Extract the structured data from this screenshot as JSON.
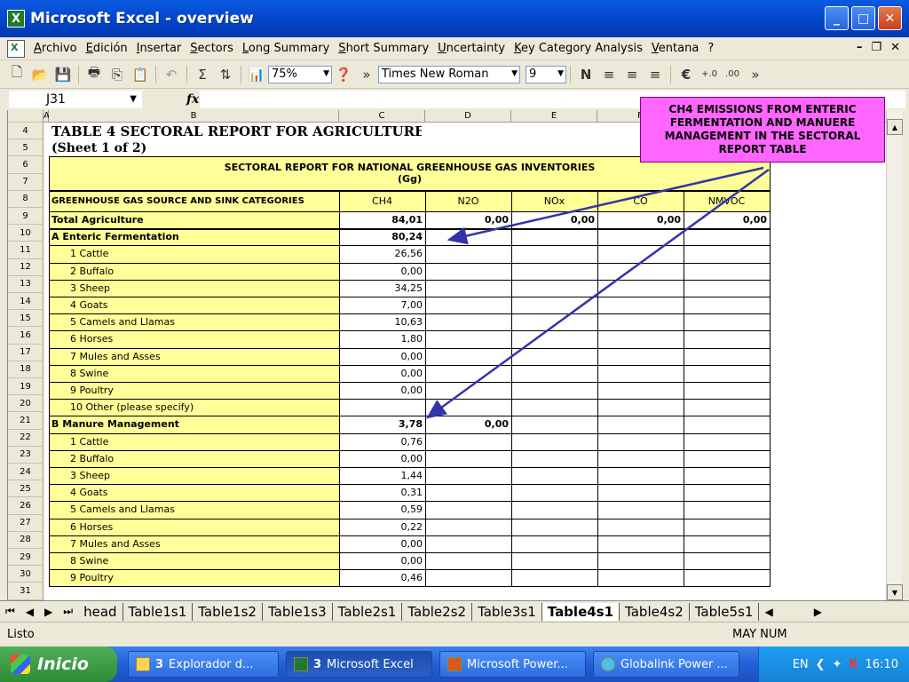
{
  "window": {
    "title": "Microsoft Excel - overview",
    "app_letter": "X"
  },
  "menu": [
    "Archivo",
    "Edición",
    "Insertar",
    "Sectors",
    "Long Summary",
    "Short Summary",
    "Uncertainty",
    "Key Category Analysis",
    "Ventana",
    "?"
  ],
  "toolbar": {
    "zoom": "75%",
    "font": "Times New Roman",
    "size": "9",
    "euro": "€"
  },
  "formula": {
    "cell_ref": "J31",
    "fx": "fx",
    "value": ""
  },
  "columns": [
    "A",
    "B",
    "C",
    "D",
    "E",
    "F"
  ],
  "rows": [
    "4",
    "5",
    "6",
    "7",
    "8",
    "9",
    "10",
    "11",
    "12",
    "13",
    "14",
    "15",
    "16",
    "17",
    "18",
    "19",
    "20",
    "21",
    "22",
    "23",
    "24",
    "25",
    "26",
    "27",
    "28",
    "29",
    "30",
    "31"
  ],
  "table": {
    "title": "TABLE 4 SECTORAL REPORT FOR AGRICULTURE",
    "subtitle": "(Sheet 1 of 2)",
    "report_heading": "SECTORAL REPORT FOR NATIONAL GREENHOUSE GAS INVENTORIES",
    "units": "(Gg)",
    "header_label": "GREENHOUSE GAS SOURCE AND SINK CATEGORIES",
    "gas_headers": [
      "CH4",
      "N2O",
      "NOx",
      "CO",
      "NMVOC"
    ],
    "body": [
      {
        "label": "Total Agriculture",
        "bold": true,
        "values": [
          "84,01",
          "0,00",
          "0,00",
          "0,00",
          "0,00"
        ]
      },
      {
        "label": "A Enteric Fermentation",
        "bold": true,
        "values": [
          "80,24",
          "",
          "",
          "",
          ""
        ]
      },
      {
        "label": "1  Cattle",
        "values": [
          "26,56",
          "",
          "",
          "",
          ""
        ]
      },
      {
        "label": "2  Buffalo",
        "values": [
          "0,00",
          "",
          "",
          "",
          ""
        ]
      },
      {
        "label": "3  Sheep",
        "values": [
          "34,25",
          "",
          "",
          "",
          ""
        ]
      },
      {
        "label": "4  Goats",
        "values": [
          "7,00",
          "",
          "",
          "",
          ""
        ]
      },
      {
        "label": "5  Camels and Llamas",
        "values": [
          "10,63",
          "",
          "",
          "",
          ""
        ]
      },
      {
        "label": "6  Horses",
        "values": [
          "1,80",
          "",
          "",
          "",
          ""
        ]
      },
      {
        "label": "7  Mules and Asses",
        "values": [
          "0,00",
          "",
          "",
          "",
          ""
        ]
      },
      {
        "label": "8  Swine",
        "values": [
          "0,00",
          "",
          "",
          "",
          ""
        ]
      },
      {
        "label": "9  Poultry",
        "values": [
          "0,00",
          "",
          "",
          "",
          ""
        ]
      },
      {
        "label": "10  Other (please specify)",
        "values": [
          "",
          "",
          "",
          "",
          ""
        ]
      },
      {
        "label": "B  Manure Management",
        "bold": true,
        "values": [
          "3,78",
          "0,00",
          "",
          "",
          ""
        ]
      },
      {
        "label": "1  Cattle",
        "values": [
          "0,76",
          "",
          "",
          "",
          ""
        ]
      },
      {
        "label": "2  Buffalo",
        "values": [
          "0,00",
          "",
          "",
          "",
          ""
        ]
      },
      {
        "label": "3  Sheep",
        "values": [
          "1,44",
          "",
          "",
          "",
          ""
        ]
      },
      {
        "label": "4  Goats",
        "values": [
          "0,31",
          "",
          "",
          "",
          ""
        ]
      },
      {
        "label": "5  Camels and Llamas",
        "values": [
          "0,59",
          "",
          "",
          "",
          ""
        ]
      },
      {
        "label": "6  Horses",
        "values": [
          "0,22",
          "",
          "",
          "",
          ""
        ]
      },
      {
        "label": "7  Mules and Asses",
        "values": [
          "0,00",
          "",
          "",
          "",
          ""
        ]
      },
      {
        "label": "8  Swine",
        "values": [
          "0,00",
          "",
          "",
          "",
          ""
        ]
      },
      {
        "label": "9  Poultry",
        "values": [
          "0,46",
          "",
          "",
          "",
          ""
        ]
      }
    ]
  },
  "callout": {
    "text": "CH4 EMISSIONS FROM ENTERIC FERMENTATION AND MANUERE MANAGEMENT IN THE SECTORAL REPORT TABLE",
    "color": "#ff66ff",
    "arrow_color": "#3333aa"
  },
  "sheet_tabs": [
    "head",
    "Table1s1",
    "Table1s2",
    "Table1s3",
    "Table2s1",
    "Table2s2",
    "Table3s1",
    "Table4s1",
    "Table4s2",
    "Table5s1"
  ],
  "active_tab": "Table4s1",
  "status": {
    "left": "Listo",
    "right": "MAY  NUM"
  },
  "taskbar": {
    "start": "Inicio",
    "tasks": [
      {
        "count": "3",
        "label": "Explorador d..."
      },
      {
        "count": "3",
        "label": "Microsoft Excel"
      },
      {
        "count": "",
        "label": "Microsoft Power..."
      },
      {
        "count": "",
        "label": "Globalink Power ..."
      }
    ],
    "lang": "EN",
    "clock": "16:10"
  }
}
